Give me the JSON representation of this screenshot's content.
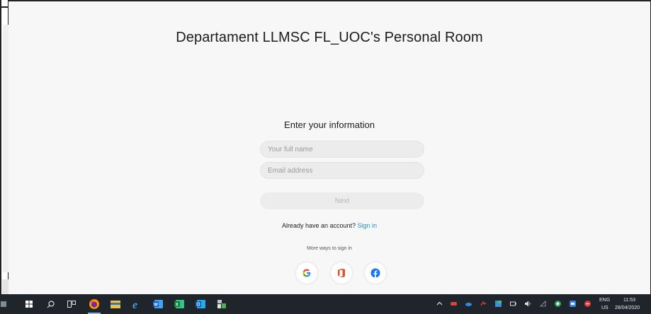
{
  "room": {
    "title": "Departament LLMSC FL_UOC's Personal Room"
  },
  "form": {
    "heading": "Enter your information",
    "name_placeholder": "Your full name",
    "email_placeholder": "Email address",
    "next_label": "Next",
    "account_prompt": "Already have an account?",
    "sign_in_label": "Sign in",
    "more_ways_label": "More ways to sign in"
  },
  "social_icons": [
    "google-icon",
    "office-icon",
    "facebook-icon"
  ],
  "taskbar": {
    "pinned_icons": [
      "windows-start-icon",
      "search-icon",
      "task-view-icon",
      "firefox-icon",
      "file-explorer-icon",
      "internet-explorer-icon",
      "word-icon",
      "excel-icon",
      "outlook-icon",
      "app-icon"
    ],
    "tray_icons": [
      "chevron-up-icon",
      "tray-app-icon",
      "onedrive-icon",
      "network-icon",
      "tray-app-icon",
      "battery-icon",
      "speaker-icon",
      "wifi-icon",
      "tray-app-icon",
      "tray-app-icon",
      "tray-app-icon"
    ],
    "language_top": "ENG",
    "language_bottom": "US",
    "time": "11:53",
    "date": "28/04/2020"
  },
  "colors": {
    "link": "#1f8fd7",
    "background": "#f7f7f7",
    "taskbar": "#20252b"
  }
}
